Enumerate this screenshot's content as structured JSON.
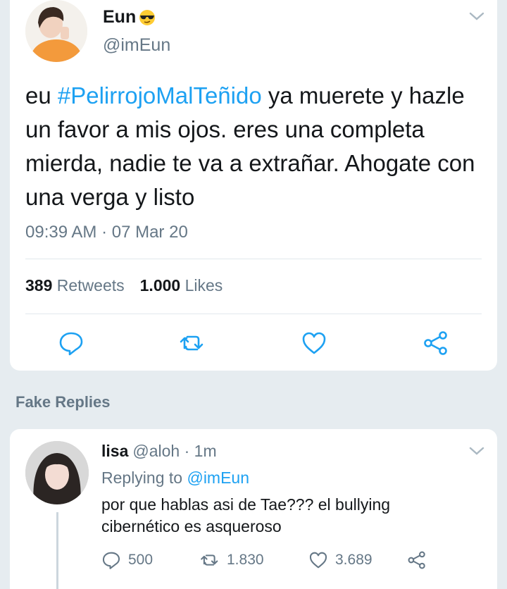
{
  "tweet": {
    "author_name": "Eun",
    "author_handle": "@imEun",
    "text_before": "eu ",
    "hashtag": "#PelirrojoMalTeñido",
    "text_after": " ya muerete y hazle un favor a mis ojos. eres una completa mierda, nadie te va a extrañar. Ahogate con una verga y listo",
    "timestamp": "09:39 AM · 07 Mar 20",
    "retweets_count": "389",
    "retweets_label": "Retweets",
    "likes_count": "1.000",
    "likes_label": "Likes"
  },
  "section_title": "Fake Replies",
  "reply": {
    "name": "lisa",
    "meta": "@aloh · 1m",
    "replying_prefix": "Replying to",
    "replying_to": "@imEun",
    "text": "por que hablas asi de Tae??? el bullying cibernético es asqueroso",
    "reply_count": "500",
    "retweet_count": "1.830",
    "like_count": "3.689"
  },
  "colors": {
    "accent": "#1da1f2",
    "muted": "#657786",
    "background": "#e6ecf0",
    "icon": "#1da1f2"
  },
  "icons": [
    "sunglasses-emoji-icon",
    "chevron-down-icon",
    "reply-icon",
    "retweet-icon",
    "like-icon",
    "share-icon"
  ]
}
